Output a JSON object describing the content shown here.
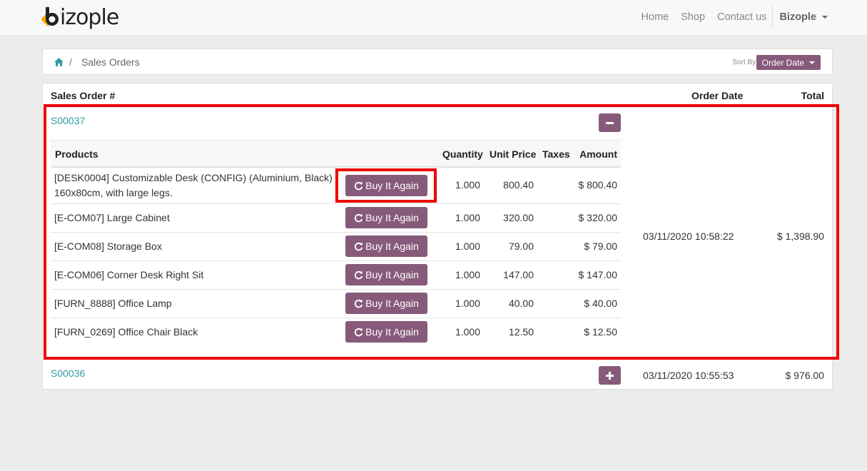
{
  "navbar": {
    "logo_text": "izople",
    "links": [
      "Home",
      "Shop",
      "Contact us"
    ],
    "user": "Bizople"
  },
  "breadcrumb": {
    "home_icon": "home-icon",
    "separator": "/",
    "current": "Sales Orders",
    "sort_label": "Sort By:",
    "sort_value": "Order Date"
  },
  "table": {
    "headers": {
      "order": "Sales Order #",
      "date": "Order Date",
      "total": "Total"
    },
    "orders": [
      {
        "number": "S00037",
        "date": "03/11/2020  10:58:22",
        "total": "$ 1,398.90",
        "expanded": true,
        "product_headers": {
          "products": "Products",
          "quantity": "Quantity",
          "unit_price": "Unit Price",
          "taxes": "Taxes",
          "amount": "Amount"
        },
        "lines": [
          {
            "name": "[DESK0004] Customizable Desk (CONFIG) (Aluminium, Black) 160x80cm, with large legs.",
            "button": "Buy It Again",
            "quantity": "1.000",
            "unit_price": "800.40",
            "taxes": "",
            "amount": "$ 800.40"
          },
          {
            "name": "[E-COM07] Large Cabinet",
            "button": "Buy It Again",
            "quantity": "1.000",
            "unit_price": "320.00",
            "taxes": "",
            "amount": "$ 320.00"
          },
          {
            "name": "[E-COM08] Storage Box",
            "button": "Buy It Again",
            "quantity": "1.000",
            "unit_price": "79.00",
            "taxes": "",
            "amount": "$ 79.00"
          },
          {
            "name": "[E-COM06] Corner Desk Right Sit",
            "button": "Buy It Again",
            "quantity": "1.000",
            "unit_price": "147.00",
            "taxes": "",
            "amount": "$ 147.00"
          },
          {
            "name": "[FURN_8888] Office Lamp",
            "button": "Buy It Again",
            "quantity": "1.000",
            "unit_price": "40.00",
            "taxes": "",
            "amount": "$ 40.00"
          },
          {
            "name": "[FURN_0269] Office Chair Black",
            "button": "Buy It Again",
            "quantity": "1.000",
            "unit_price": "12.50",
            "taxes": "",
            "amount": "$ 12.50"
          }
        ]
      },
      {
        "number": "S00036",
        "date": "03/11/2020  10:55:53",
        "total": "$ 976.00",
        "expanded": false
      }
    ]
  },
  "colors": {
    "primary": "#875a7b",
    "link": "#2f9ca5",
    "highlight": "#ee0000",
    "logo_accent": "#f5a300"
  }
}
